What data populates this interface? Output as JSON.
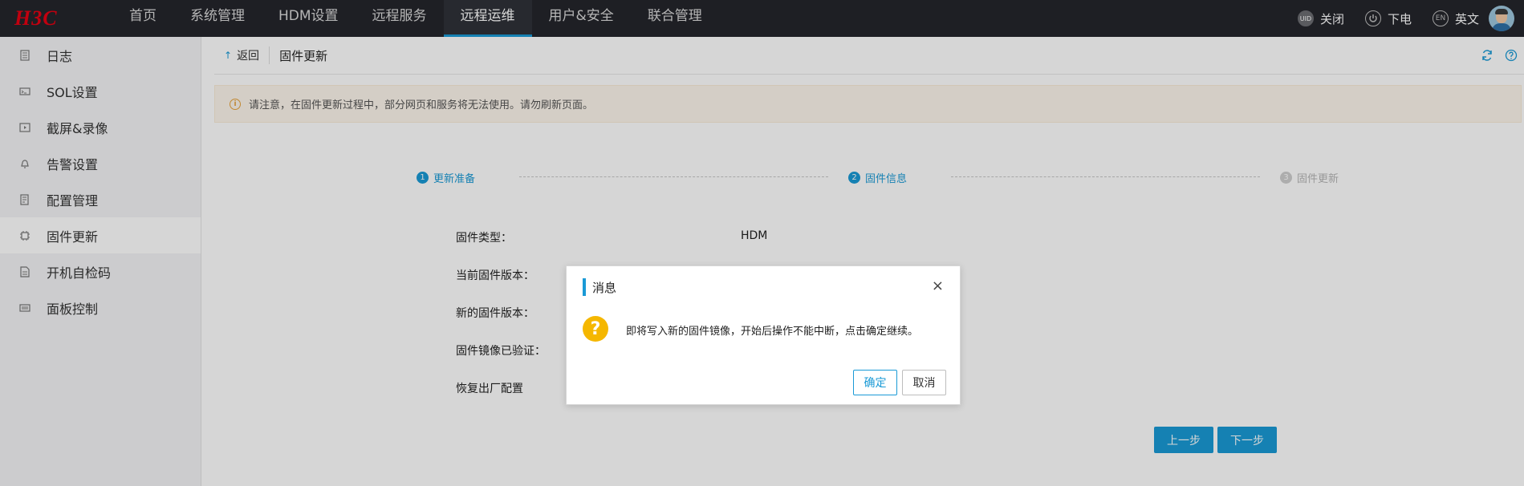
{
  "brand": {
    "logo_text": "H3C"
  },
  "nav": {
    "items": [
      {
        "label": "首页"
      },
      {
        "label": "系统管理"
      },
      {
        "label": "HDM设置"
      },
      {
        "label": "远程服务"
      },
      {
        "label": "远程运维",
        "active": true
      },
      {
        "label": "用户&安全"
      },
      {
        "label": "联合管理"
      }
    ]
  },
  "top_right": {
    "uid_badge": "UID",
    "uid_label": "关闭",
    "power_label": "下电",
    "lang_badge": "EN",
    "lang_label": "英文"
  },
  "sidebar": {
    "items": [
      {
        "label": "日志",
        "icon": "log-icon"
      },
      {
        "label": "SOL设置",
        "icon": "sol-icon"
      },
      {
        "label": "截屏&录像",
        "icon": "video-icon"
      },
      {
        "label": "告警设置",
        "icon": "bell-icon"
      },
      {
        "label": "配置管理",
        "icon": "config-icon"
      },
      {
        "label": "固件更新",
        "icon": "chip-icon",
        "active": true
      },
      {
        "label": "开机自检码",
        "icon": "post-code-icon"
      },
      {
        "label": "面板控制",
        "icon": "panel-icon"
      }
    ]
  },
  "header": {
    "back_label": "返回",
    "title": "固件更新"
  },
  "notice": {
    "text": "请注意，在固件更新过程中，部分网页和服务将无法使用。请勿刷新页面。"
  },
  "steps": [
    {
      "number": "1",
      "label": "更新准备",
      "state": "done"
    },
    {
      "number": "2",
      "label": "固件信息",
      "state": "done"
    },
    {
      "number": "3",
      "label": "固件更新",
      "state": "pending"
    }
  ],
  "form": {
    "type_label": "固件类型：",
    "type_value": "HDM",
    "current_label": "当前固件版本：",
    "new_label": "新的固件版本：",
    "verified_label": "固件镜像已验证：",
    "restore_label": "恢复出厂配置"
  },
  "buttons": {
    "prev": "上一步",
    "next": "下一步"
  },
  "dialog": {
    "title": "消息",
    "close_glyph": "×",
    "icon_glyph": "?",
    "message": "即将写入新的固件镜像，开始后操作不能中断，点击确定继续。",
    "ok": "确定",
    "cancel": "取消"
  },
  "colors": {
    "accent": "#1a9ad6",
    "topbar": "#24252c",
    "brand_red": "#e60012",
    "warning": "#e6a23c",
    "question": "#f5b700"
  }
}
